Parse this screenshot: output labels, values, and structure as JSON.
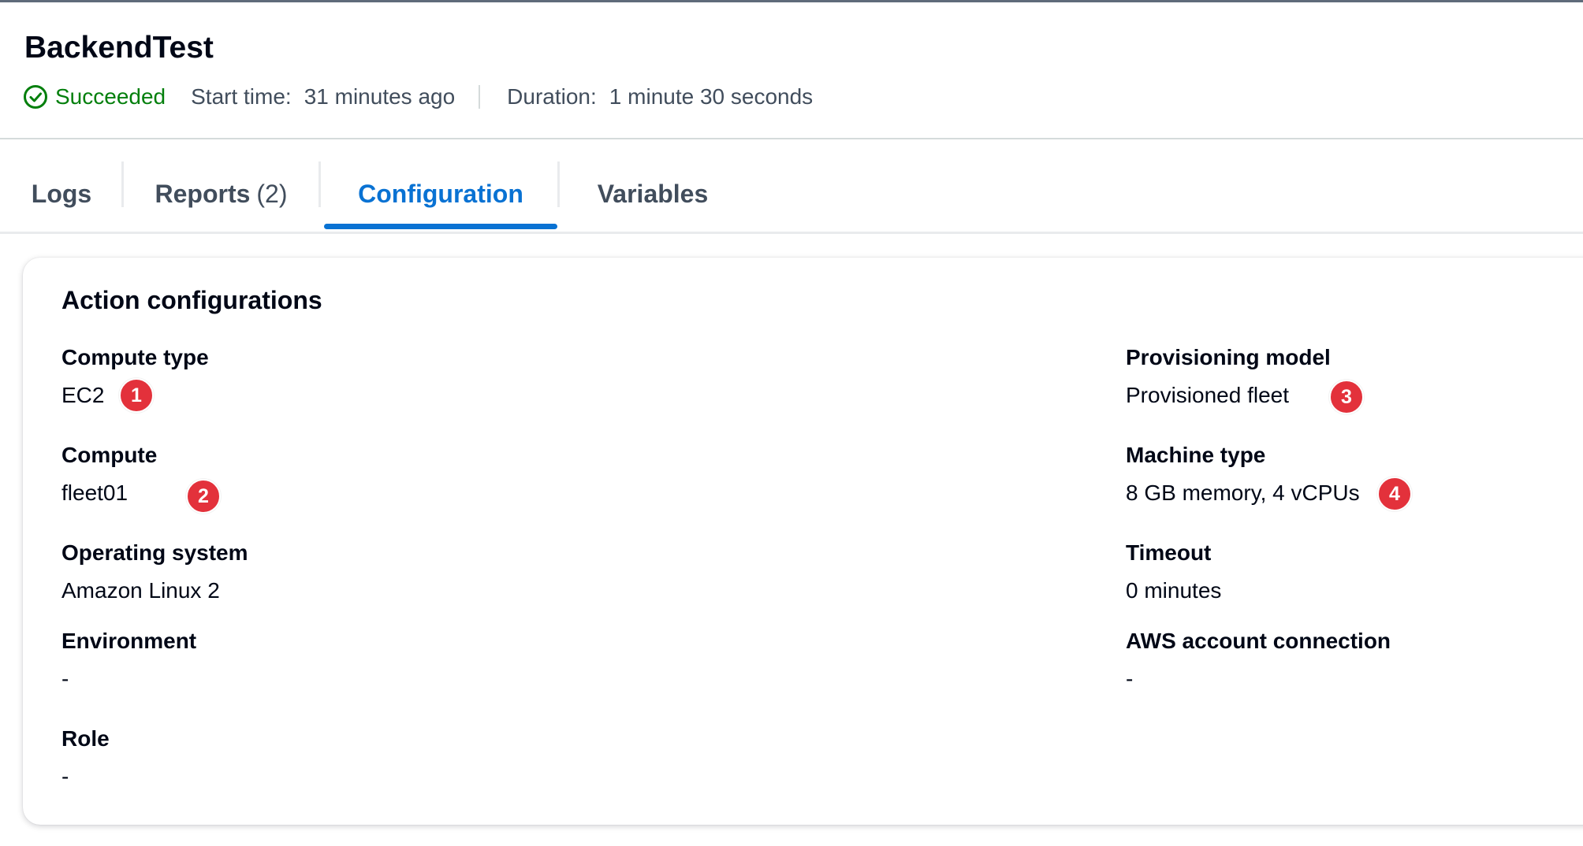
{
  "header": {
    "title": "BackendTest",
    "status": "Succeeded",
    "start_time_label": "Start time:",
    "start_time_value": "31 minutes ago",
    "duration_label": "Duration:",
    "duration_value": "1 minute 30 seconds"
  },
  "tabs": [
    {
      "label": "Logs",
      "count": ""
    },
    {
      "label": "Reports",
      "count": "(2)"
    },
    {
      "label": "Configuration",
      "count": ""
    },
    {
      "label": "Variables",
      "count": ""
    }
  ],
  "active_tab": "Configuration",
  "card": {
    "title": "Action configurations",
    "left": [
      {
        "key": "Compute type",
        "value": "EC2"
      },
      {
        "key": "Compute",
        "value": "fleet01"
      },
      {
        "key": "Operating system",
        "value": "Amazon Linux 2"
      },
      {
        "key": "Environment",
        "value": "-"
      },
      {
        "key": "Role",
        "value": "-"
      }
    ],
    "right": [
      {
        "key": "Provisioning model",
        "value": "Provisioned fleet"
      },
      {
        "key": "Machine type",
        "value": "8 GB memory, 4 vCPUs"
      },
      {
        "key": "Timeout",
        "value": "0 minutes"
      },
      {
        "key": "AWS account connection",
        "value": "-"
      }
    ]
  },
  "callouts": [
    "1",
    "2",
    "3",
    "4"
  ],
  "colors": {
    "success": "#037f0c",
    "accent": "#0972d3",
    "callout": "#e3313b",
    "text": "#000716",
    "muted": "#414d5c"
  }
}
